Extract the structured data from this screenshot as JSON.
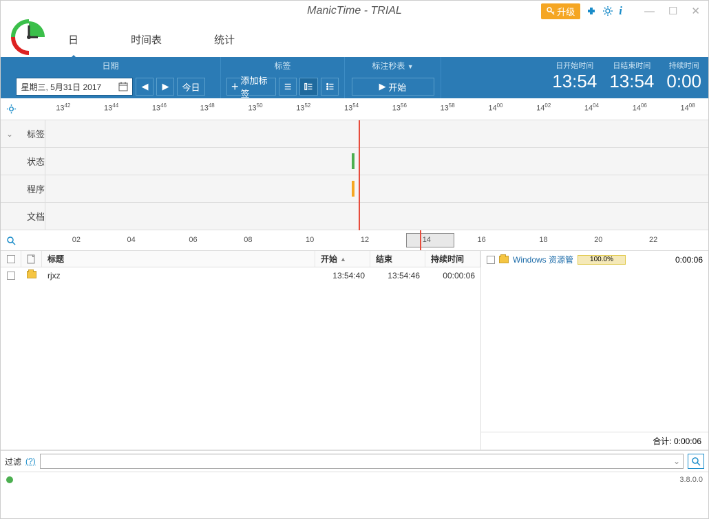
{
  "window": {
    "title": "ManicTime - TRIAL",
    "upgrade": "升级",
    "version": "3.8.0.0"
  },
  "nav": {
    "day": "日",
    "schedule": "时间表",
    "stats": "统计"
  },
  "toolbar": {
    "date_label": "日期",
    "date_value": "星期三, 5月31日 2017",
    "today": "今日",
    "tag_label": "标签",
    "add_tag": "添加标签",
    "stopwatch_label": "标注秒表",
    "start": "开始"
  },
  "times": {
    "start_label": "日开始时间",
    "start_val": "13:54",
    "end_label": "日结束时间",
    "end_val": "13:54",
    "dur_label": "持续时间",
    "dur_val": "0:00"
  },
  "timeline": {
    "rows": {
      "tags": "标签",
      "state": "状态",
      "program": "程序",
      "document": "文档"
    },
    "ticks": [
      "1342",
      "1344",
      "1346",
      "1348",
      "1350",
      "1352",
      "1354",
      "1356",
      "1358",
      "1400",
      "1402",
      "1404",
      "1406",
      "1408"
    ],
    "hours": [
      "02",
      "04",
      "06",
      "08",
      "10",
      "12",
      "14",
      "16",
      "18",
      "20",
      "22"
    ]
  },
  "grid": {
    "head": {
      "title": "标题",
      "start": "开始",
      "end": "结束",
      "dur": "持续时间"
    },
    "row1": {
      "title": "rjxz",
      "start": "13:54:40",
      "end": "13:54:46",
      "dur": "00:00:06"
    }
  },
  "summary": {
    "app": "Windows 资源管",
    "pct": "100.0%",
    "dur": "0:00:06",
    "total_label": "合计:",
    "total_val": "0:00:06"
  },
  "filter": {
    "label": "过滤",
    "q": "(?)"
  }
}
